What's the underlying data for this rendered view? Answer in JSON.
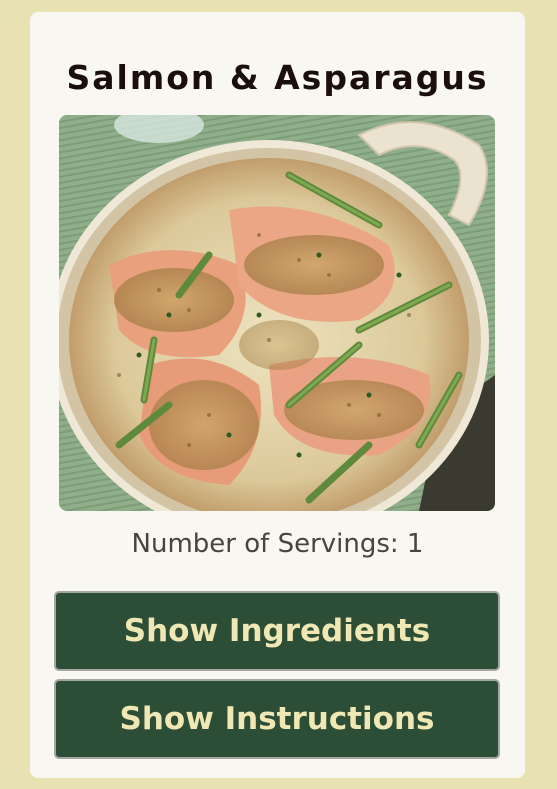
{
  "recipe": {
    "title": "Salmon & Asparagus",
    "servings_text": "Number of Servings: 1",
    "image_alt": "Salmon & Asparagus"
  },
  "buttons": {
    "show_ingredients": "Show Ingredients",
    "show_instructions": "Show Instructions"
  },
  "colors": {
    "page_background": "#e8e2b2",
    "card_background": "#f8f7f2",
    "button_background": "#2c4d36",
    "button_text": "#f0e8b4",
    "title_text": "#1a0f0d"
  }
}
